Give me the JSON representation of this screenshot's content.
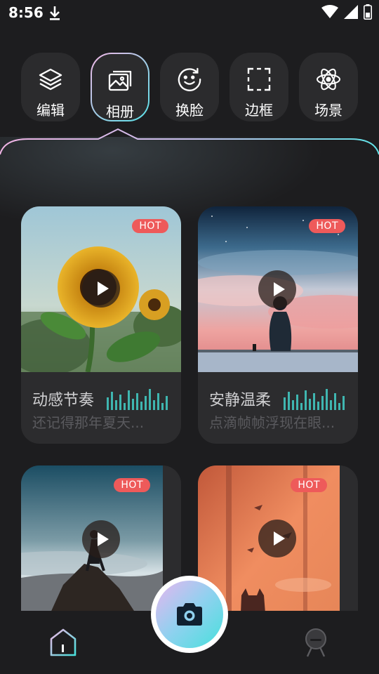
{
  "status": {
    "time": "8:56"
  },
  "tools": [
    {
      "label": "编辑",
      "icon": "layers-icon"
    },
    {
      "label": "相册",
      "icon": "gallery-icon",
      "active": true
    },
    {
      "label": "换脸",
      "icon": "face-swap-icon"
    },
    {
      "label": "边框",
      "icon": "frame-icon"
    },
    {
      "label": "场景",
      "icon": "atom-icon"
    }
  ],
  "cards": [
    {
      "badge": "HOT",
      "title": "动感节奏",
      "subtitle": "还记得那年夏天...",
      "image": "sunflower"
    },
    {
      "badge": "HOT",
      "title": "安静温柔",
      "subtitle": "点滴帧帧浮现在眼...",
      "image": "person-sunset-sky"
    },
    {
      "badge": "HOT",
      "image": "hiker-on-mountain"
    },
    {
      "badge": "HOT",
      "image": "orange-window-cat"
    }
  ],
  "colors": {
    "accent_start": "#f3b6e6",
    "accent_end": "#47e0dc",
    "hot": "#ee5a5a"
  },
  "nav": {
    "home": "home-icon",
    "camera": "camera-icon",
    "profile": "profile-icon"
  }
}
